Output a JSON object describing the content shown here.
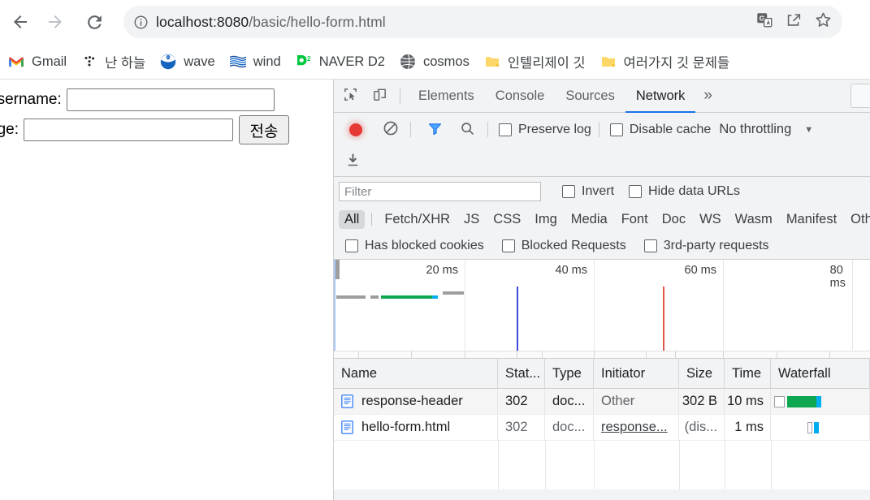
{
  "browser": {
    "nav": {
      "back_icon": "arrow-left-icon",
      "forward_icon": "arrow-right-icon",
      "reload_icon": "reload-icon"
    },
    "omnibox": {
      "info_icon": "info-circle-icon",
      "host": "localhost:8080",
      "path": "/basic/hello-form.html",
      "full_url": "localhost:8080/basic/hello-form.html",
      "translate_icon": "google-translate-icon",
      "share_icon": "share-icon",
      "bookmark_icon": "star-outline-icon"
    },
    "bookmarks": [
      {
        "label": "Gmail",
        "icon": "gmail-icon"
      },
      {
        "label": "난 하늘",
        "icon": "dots-icon"
      },
      {
        "label": "wave",
        "icon": "noaa-icon"
      },
      {
        "label": "wind",
        "icon": "wind-icon"
      },
      {
        "label": "NAVER D2",
        "icon": "naver-d2-icon"
      },
      {
        "label": "cosmos",
        "icon": "globe-icon"
      },
      {
        "label": "인텔리제이 깃",
        "icon": "folder-icon"
      },
      {
        "label": "여러가지 깃 문제들",
        "icon": "folder-icon"
      }
    ]
  },
  "page": {
    "fields": [
      {
        "label": "username:",
        "value": "",
        "name": "username"
      },
      {
        "label": "age:",
        "value": "",
        "name": "age"
      }
    ],
    "submit_label": "전송"
  },
  "devtools": {
    "toolbar": {
      "inspect_icon": "inspect-element-icon",
      "device_toggle_icon": "device-toolbar-icon",
      "more_tabs_label": "»"
    },
    "tabs": [
      {
        "label": "Elements",
        "active": false
      },
      {
        "label": "Console",
        "active": false
      },
      {
        "label": "Sources",
        "active": false
      },
      {
        "label": "Network",
        "active": true
      }
    ],
    "controls": {
      "record_icon": "record-stop-icon",
      "clear_icon": "clear-no-entry-icon",
      "filter_icon": "filter-funnel-icon",
      "search_icon": "search-icon",
      "preserve_log_label": "Preserve log",
      "preserve_log_checked": false,
      "disable_cache_label": "Disable cache",
      "disable_cache_checked": false,
      "throttling_value": "No throttling",
      "throttling_caret": "▼",
      "import_har_icon": "download-arrow-icon"
    },
    "filter": {
      "placeholder": "Filter",
      "value": "",
      "invert_label": "Invert",
      "invert_checked": false,
      "hide_data_urls_label": "Hide data URLs",
      "hide_data_urls_checked": false
    },
    "type_filters": [
      {
        "label": "All",
        "active": true
      },
      {
        "label": "Fetch/XHR",
        "active": false
      },
      {
        "label": "JS",
        "active": false
      },
      {
        "label": "CSS",
        "active": false
      },
      {
        "label": "Img",
        "active": false
      },
      {
        "label": "Media",
        "active": false
      },
      {
        "label": "Font",
        "active": false
      },
      {
        "label": "Doc",
        "active": false
      },
      {
        "label": "WS",
        "active": false
      },
      {
        "label": "Wasm",
        "active": false
      },
      {
        "label": "Manifest",
        "active": false
      },
      {
        "label": "Othe",
        "active": false
      }
    ],
    "extra_filters": [
      {
        "label": "Has blocked cookies",
        "checked": false
      },
      {
        "label": "Blocked Requests",
        "checked": false
      },
      {
        "label": "3rd-party requests",
        "checked": false
      }
    ],
    "overview": {
      "ticks": [
        "20 ms",
        "40 ms",
        "60 ms",
        "80 ms"
      ],
      "markers": [
        {
          "name": "dom-content-loaded-marker",
          "color": "#3b49df"
        },
        {
          "name": "load-event-marker",
          "color": "#e2554a"
        }
      ],
      "bar_colors": {
        "queue": "#9e9e9e",
        "wait": "#0ca750",
        "download": "#00aeef"
      }
    },
    "table": {
      "columns": [
        "Name",
        "Stat...",
        "Type",
        "Initiator",
        "Size",
        "Time",
        "Waterfall"
      ],
      "rows": [
        {
          "name": "response-header",
          "status": "302",
          "type": "doc...",
          "initiator": "Other",
          "initiator_link": false,
          "size": "302 B",
          "time": "10 ms",
          "icon": "document-icon"
        },
        {
          "name": "hello-form.html",
          "status": "302",
          "type": "doc...",
          "initiator": "response...",
          "initiator_link": true,
          "size": "(dis...",
          "time": "1 ms",
          "icon": "document-icon"
        }
      ]
    },
    "colors": {
      "accent": "#1a73e8",
      "record_red": "#e53935",
      "waterfall_green": "#0ca750",
      "waterfall_blue": "#00aeef",
      "panel_bg": "#f1f3f4"
    }
  }
}
